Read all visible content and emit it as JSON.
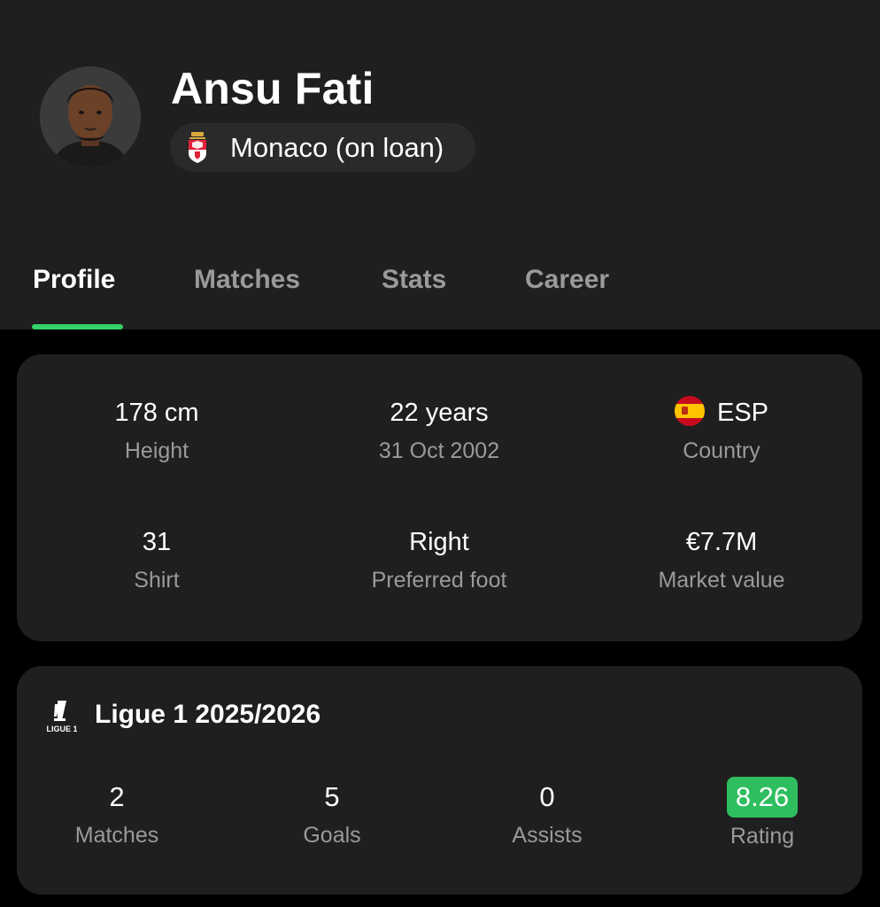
{
  "player": {
    "name": "Ansu Fati",
    "club": "Monaco (on loan)"
  },
  "tabs": [
    {
      "label": "Profile",
      "active": true
    },
    {
      "label": "Matches",
      "active": false
    },
    {
      "label": "Stats",
      "active": false
    },
    {
      "label": "Career",
      "active": false
    }
  ],
  "profile": {
    "height": {
      "value": "178 cm",
      "label": "Height"
    },
    "age": {
      "value": "22 years",
      "label": "31 Oct 2002"
    },
    "country": {
      "value": "ESP",
      "label": "Country",
      "flag_icon": "spain-flag-icon"
    },
    "shirt": {
      "value": "31",
      "label": "Shirt"
    },
    "foot": {
      "value": "Right",
      "label": "Preferred foot"
    },
    "market_value": {
      "value": "€7.7M",
      "label": "Market value"
    }
  },
  "league": {
    "title": "Ligue 1 2025/2026",
    "logo_icon": "ligue1-logo",
    "stats": [
      {
        "value": "2",
        "label": "Matches"
      },
      {
        "value": "5",
        "label": "Goals"
      },
      {
        "value": "0",
        "label": "Assists"
      },
      {
        "value": "8.26",
        "label": "Rating"
      }
    ]
  },
  "colors": {
    "accent": "#35d06a",
    "rating_badge": "#2ebe5f",
    "background": "#000000",
    "surface": "#1f1f1f",
    "muted_text": "#9a9a9a"
  }
}
